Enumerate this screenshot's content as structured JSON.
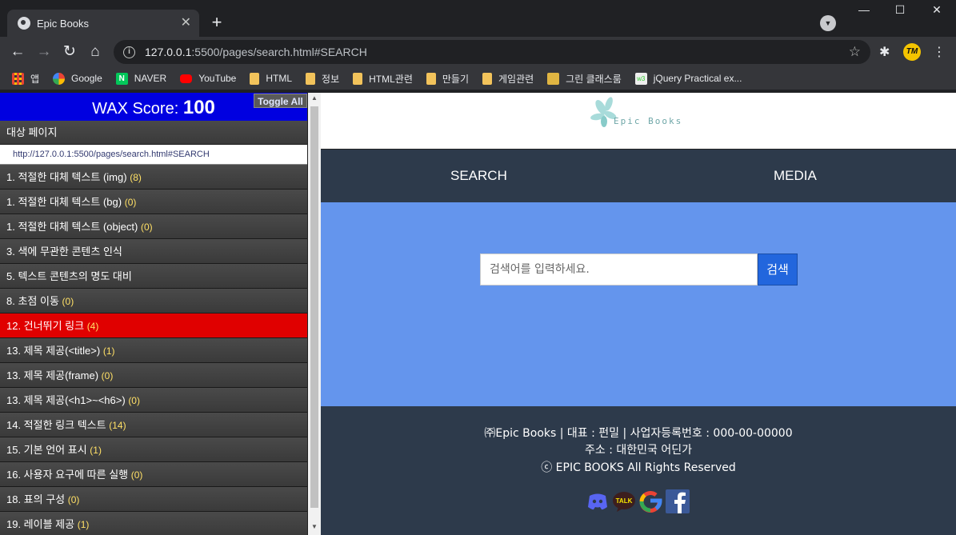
{
  "browser": {
    "tab_title": "Epic Books",
    "tab_close": "✕",
    "new_tab": "+",
    "url_host": "127.0.0.1",
    "url_rest": ":5500/pages/search.html#SEARCH",
    "window_controls": [
      "—",
      "☐",
      "✕"
    ],
    "extension_badge": "TM"
  },
  "bookmarks": [
    {
      "label": "앱",
      "icon": "apps-icon"
    },
    {
      "label": "Google",
      "icon": "google-icon"
    },
    {
      "label": "NAVER",
      "icon": "naver-icon",
      "glyph": "N"
    },
    {
      "label": "YouTube",
      "icon": "youtube-icon"
    },
    {
      "label": "HTML",
      "icon": "folder-icon"
    },
    {
      "label": "정보",
      "icon": "folder-icon"
    },
    {
      "label": "HTML관련",
      "icon": "folder-icon"
    },
    {
      "label": "만들기",
      "icon": "folder-icon"
    },
    {
      "label": "게임관련",
      "icon": "folder-icon"
    },
    {
      "label": "그린 클래스룸",
      "icon": "classroom-icon"
    },
    {
      "label": "jQuery Practical ex...",
      "icon": "w3-icon",
      "glyph": "w3"
    }
  ],
  "wax": {
    "score_label": "WAX Score:",
    "score_value": "100",
    "toggle_all": "Toggle All",
    "target_page_label": "대상 페이지",
    "target_url": "http://127.0.0.1:5500/pages/search.html#SEARCH",
    "items": [
      {
        "label": "1. 적절한 대체 텍스트 (img)",
        "count": "(8)"
      },
      {
        "label": "1. 적절한 대체 텍스트 (bg)",
        "count": "(0)"
      },
      {
        "label": "1. 적절한 대체 텍스트 (object)",
        "count": "(0)"
      },
      {
        "label": "3. 색에 무관한 콘텐츠 인식",
        "count": ""
      },
      {
        "label": "5. 텍스트 콘텐츠의 명도 대비",
        "count": ""
      },
      {
        "label": "8. 초점 이동",
        "count": "(0)"
      },
      {
        "label": "12. 건너뛰기 링크",
        "count": "(4)",
        "alert": true
      },
      {
        "label": "13. 제목 제공(<title>)",
        "count": "(1)"
      },
      {
        "label": "13. 제목 제공(frame)",
        "count": "(0)"
      },
      {
        "label": "13. 제목 제공(<h1>~<h6>)",
        "count": "(0)"
      },
      {
        "label": "14. 적절한 링크 텍스트",
        "count": "(14)"
      },
      {
        "label": "15. 기본 언어 표시",
        "count": "(1)"
      },
      {
        "label": "16. 사용자 요구에 따른 실행",
        "count": "(0)"
      },
      {
        "label": "18. 표의 구성",
        "count": "(0)"
      },
      {
        "label": "19. 레이블 제공",
        "count": "(1)"
      }
    ]
  },
  "site": {
    "logo_text": "Epic Books",
    "nav": [
      "SEARCH",
      "MEDIA"
    ],
    "search_placeholder": "검색어를 입력하세요.",
    "search_button": "검색",
    "footer_line1": "㈜Epic Books | 대표 : 펀밀 | 사업자등록번호 : 000-00-00000",
    "footer_line2": "주소 : 대한민국 어딘가",
    "footer_line3": "ⓒ EPIC BOOKS All Rights Reserved",
    "social": [
      {
        "icon": "discord-icon",
        "color": "#5865f2"
      },
      {
        "icon": "kakaotalk-icon",
        "color": "#3c1e1e",
        "glyph": "TALK"
      },
      {
        "icon": "google-icon",
        "color": "#4285f4",
        "glyph": "G"
      },
      {
        "icon": "facebook-icon",
        "color": "#3b5998",
        "glyph": "f"
      }
    ]
  }
}
